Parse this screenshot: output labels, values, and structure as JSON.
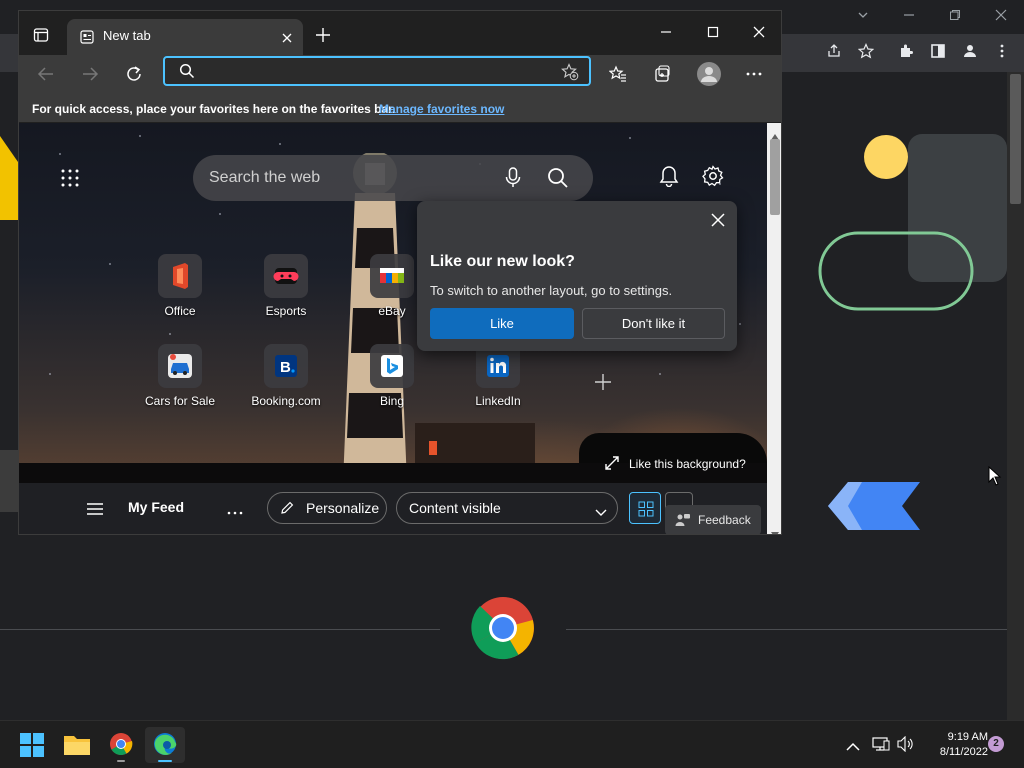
{
  "chrome_window": {
    "controls": {
      "minimize_icon": "minimize-icon",
      "restore_icon": "restore-icon",
      "close_icon": "close-icon",
      "dropdown_icon": "chevron-down-icon"
    },
    "toolbar_icons": [
      "share-icon",
      "star-icon",
      "extensions-icon",
      "sidebar-icon",
      "profile-icon",
      "more-icon"
    ]
  },
  "edge_window": {
    "tab": {
      "title": "New tab"
    },
    "window_controls": [
      "minimize-icon",
      "maximize-icon",
      "close-icon"
    ],
    "address_bar": {
      "value": "",
      "placeholder": ""
    },
    "favorites_bar": {
      "message": "For quick access, place your favorites here on the favorites bar.",
      "link": "Manage favorites now"
    },
    "ntp": {
      "search": {
        "placeholder": "Search the web"
      },
      "quick_links": [
        {
          "label": "Office",
          "icon": "office-icon"
        },
        {
          "label": "Esports",
          "icon": "gamepad-icon"
        },
        {
          "label": "eBay",
          "icon": "ebay-icon"
        },
        {
          "label": "Cars for Sale",
          "icon": "car-icon"
        },
        {
          "label": "Booking.com",
          "icon": "booking-icon"
        },
        {
          "label": "Bing",
          "icon": "bing-icon"
        },
        {
          "label": "LinkedIn",
          "icon": "linkedin-icon"
        }
      ],
      "add_link_icon": "plus-icon",
      "background_link": "Like this background?",
      "popup": {
        "title": "Like our new look?",
        "body": "To switch to another layout, go to settings.",
        "like_label": "Like",
        "dislike_label": "Don't like it"
      },
      "feed": {
        "title": "My Feed",
        "personalize_label": "Personalize",
        "content_select": "Content visible",
        "feedback_label": "Feedback"
      }
    }
  },
  "taskbar": {
    "apps": [
      "start-icon",
      "file-explorer-icon",
      "chrome-icon",
      "edge-icon"
    ],
    "clock_time": "9:19 AM",
    "clock_date": "8/11/2022",
    "notification_count": "2"
  },
  "colors": {
    "edge_accent": "#4cc2ff",
    "like_button": "#0f6cbd",
    "chrome_bg": "#202124",
    "taskbar_bg": "#1f1f1f"
  }
}
